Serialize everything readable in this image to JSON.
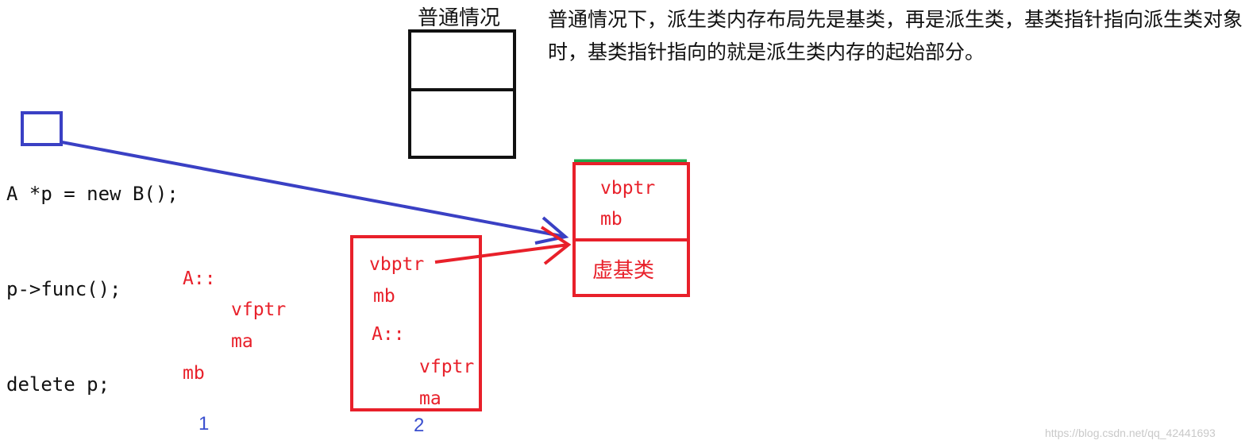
{
  "title": "普通情况",
  "description": "普通情况下，派生类内存布局先是基类，再是派生类，基类指针指向派生类对象时，基类指针指向的就是派生类内存的起始部分。",
  "code": {
    "line1_prefix": "A ",
    "line1_highlight": "*p",
    "line1_suffix": " = new B();",
    "line2": "p->func();",
    "line3": "delete p;"
  },
  "layout1": {
    "label": "1",
    "lines": [
      "A::",
      "vfptr",
      "ma",
      "mb"
    ]
  },
  "layout2": {
    "label": "2",
    "lines": [
      "vbptr",
      "mb",
      "A::",
      "vfptr",
      "ma"
    ]
  },
  "layout3": {
    "lines": [
      "vbptr",
      "mb"
    ],
    "virtual_base": "虚基类"
  },
  "watermark": "https://blog.csdn.net/qq_42441693",
  "colors": {
    "red": "#e8202a",
    "blue": "#3a40c4",
    "green": "#1fa84a",
    "black": "#111111",
    "label_blue": "#3a4fcf"
  }
}
